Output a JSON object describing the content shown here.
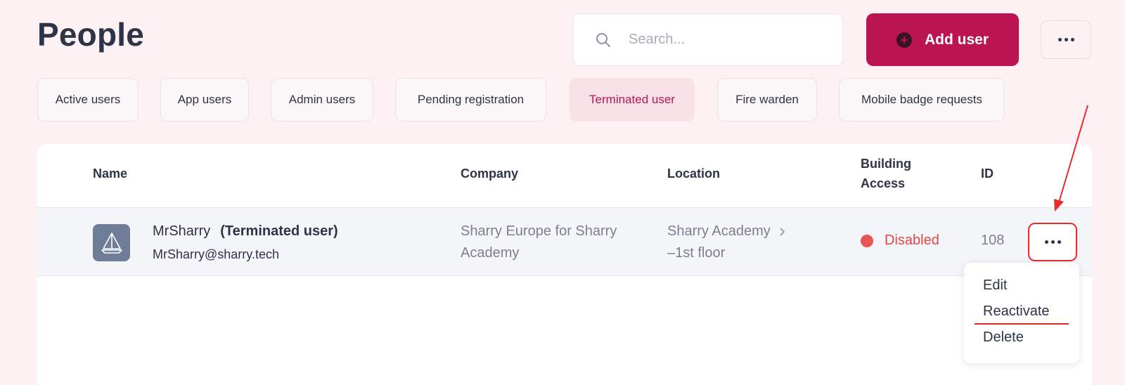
{
  "header": {
    "title": "People",
    "search_placeholder": "Search...",
    "add_user_label": "Add user"
  },
  "tabs": [
    {
      "label": "Active users",
      "active": false
    },
    {
      "label": "App users",
      "active": false
    },
    {
      "label": "Admin users",
      "active": false
    },
    {
      "label": "Pending registration",
      "active": false
    },
    {
      "label": "Terminated user",
      "active": true
    },
    {
      "label": "Fire warden",
      "active": false
    },
    {
      "label": "Mobile badge requests",
      "active": false
    }
  ],
  "table": {
    "columns": {
      "name": "Name",
      "company": "Company",
      "location": "Location",
      "building_access_line1": "Building",
      "building_access_line2": "Access",
      "id": "ID"
    },
    "rows": [
      {
        "name": "MrSharry",
        "tag": "(Terminated user)",
        "email": "MrSharry@sharry.tech",
        "company_line1": "Sharry Europe for Sharry",
        "company_line2": "Academy",
        "location_line1": "Sharry Academy",
        "location_line2": "–1st floor",
        "access_status": "Disabled",
        "id": "108"
      }
    ]
  },
  "row_menu": {
    "items": [
      "Edit",
      "Reactivate",
      "Delete"
    ]
  },
  "colors": {
    "brand": "#bb1551",
    "background": "#fdf1f3",
    "disabled": "#e04848",
    "annotation": "#ea2b2b"
  },
  "icons": {
    "search": "search-icon",
    "add": "plus-circle-icon",
    "more": "more-dots-icon",
    "avatar": "sailboat-icon",
    "chevron": "chevron-right-icon"
  }
}
